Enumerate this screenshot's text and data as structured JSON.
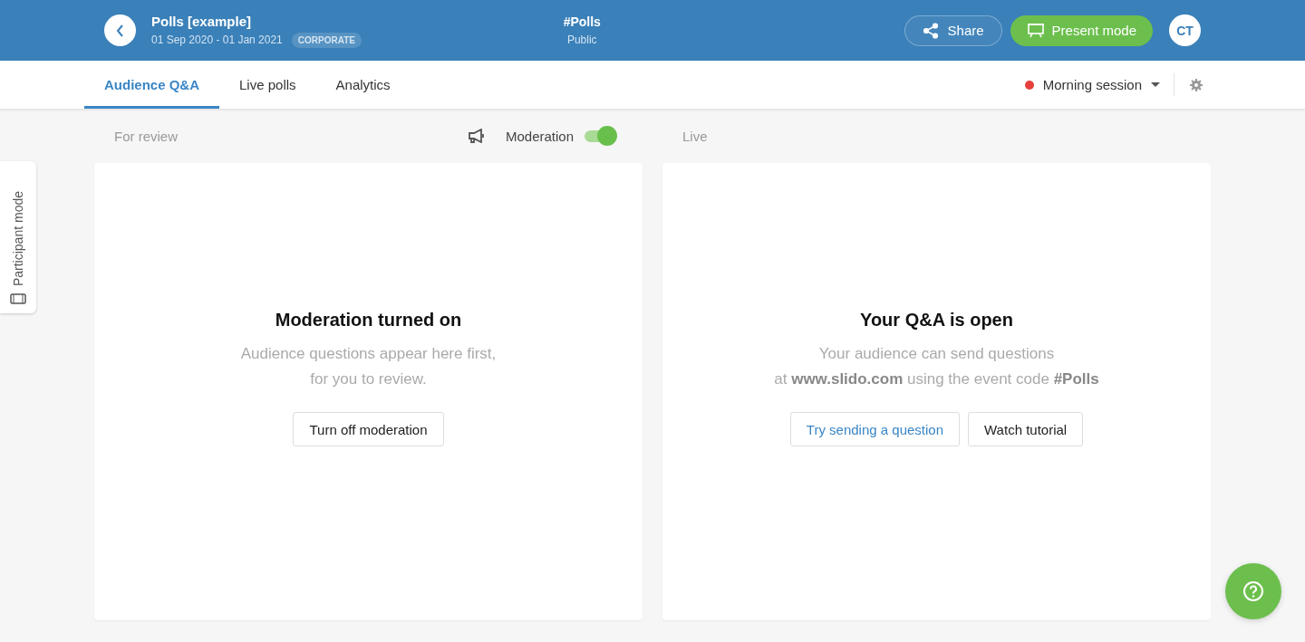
{
  "header": {
    "event_title": "Polls [example]",
    "dates": "01 Sep 2020 - 01 Jan 2021",
    "badge": "CORPORATE",
    "event_code": "#Polls",
    "visibility": "Public",
    "share_label": "Share",
    "present_label": "Present mode",
    "avatar_initials": "CT"
  },
  "tabs": [
    {
      "label": "Audience Q&A",
      "selected": true
    },
    {
      "label": "Live polls",
      "selected": false
    },
    {
      "label": "Analytics",
      "selected": false
    }
  ],
  "session": {
    "label": "Morning session",
    "color": "#e8403c"
  },
  "columns": {
    "left_label": "For review",
    "moderation_label": "Moderation",
    "moderation_on": true,
    "right_label": "Live"
  },
  "side_tab": "Participant mode",
  "cards": [
    {
      "title": "Moderation turned on",
      "lines": [
        "Audience questions appear here first,",
        "for you to review."
      ],
      "buttons": [
        {
          "label": "Turn off moderation",
          "kind": "plain"
        }
      ]
    },
    {
      "title": "Your Q&A is open",
      "lines": [
        "Your audience can send questions",
        "at **www.slido.com** using the event code **#Polls**"
      ],
      "buttons": [
        {
          "label": "Try sending a question",
          "kind": "link"
        },
        {
          "label": "Watch tutorial",
          "kind": "plain"
        }
      ]
    }
  ]
}
